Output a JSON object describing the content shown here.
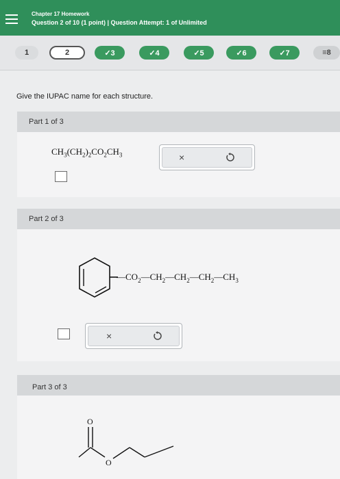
{
  "header": {
    "title": "Chapter 17 Homework",
    "subtitle": "Question 2 of 10 (1 point)  |  Question Attempt: 1 of Unlimited"
  },
  "question_nav": {
    "items": [
      {
        "label": "1",
        "state": "plain"
      },
      {
        "label": "2",
        "state": "current"
      },
      {
        "label": "✓3",
        "state": "done"
      },
      {
        "label": "✓4",
        "state": "done"
      },
      {
        "label": "✓5",
        "state": "done"
      },
      {
        "label": "✓6",
        "state": "done"
      },
      {
        "label": "✓7",
        "state": "done"
      },
      {
        "label": "≡8",
        "state": "gray"
      }
    ]
  },
  "prompt": "Give the IUPAC name for each structure.",
  "parts": [
    {
      "label": "Part 1 of 3"
    },
    {
      "label": "Part 2 of 3"
    },
    {
      "label": "Part 3 of 3"
    }
  ],
  "part2_structure": {
    "chain": [
      "—CO",
      "2",
      "—CH",
      "2",
      "—CH",
      "2",
      "—CH",
      "2",
      "—CH",
      "3"
    ]
  },
  "part3_structure": {
    "carbonyl_o": "O",
    "ester_o": "O"
  },
  "tools": {
    "clear_symbol": "×"
  },
  "colors": {
    "header_green": "#2f8f5a",
    "done_green": "#3a9a5f"
  }
}
